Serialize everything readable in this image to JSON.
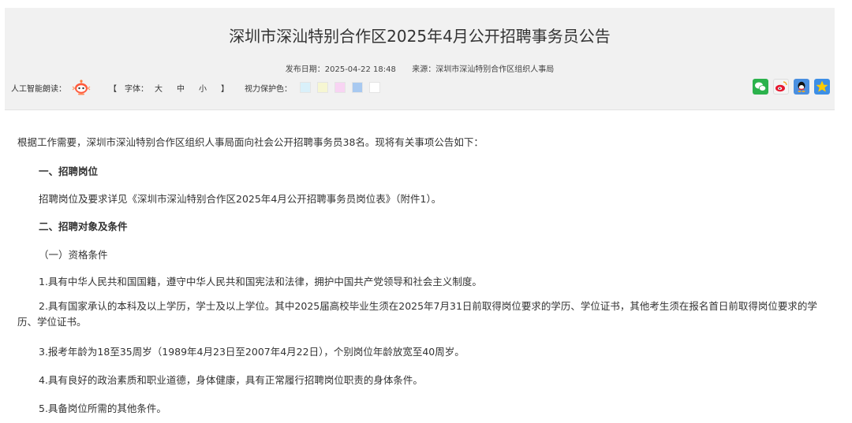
{
  "header": {
    "title": "深圳市深汕特别合作区2025年4月公开招聘事务员公告",
    "publish_label": "发布日期：",
    "publish_date": "2025-04-22 18:48",
    "source_label": "来源：",
    "source": "深圳市深汕特别合作区组织人事局"
  },
  "tools": {
    "ai_read_label": "人工智能朗读：",
    "font_bracket_open": "【",
    "font_label": "字体：",
    "font_large": "大",
    "font_medium": "中",
    "font_small": "小",
    "font_bracket_close": "】",
    "eye_protect_label": "视力保护色：",
    "eye_colors": [
      "#d9f0fa",
      "#f6f6d2",
      "#f8d4f3",
      "#a8c9f0",
      "#ffffff"
    ]
  },
  "share": [
    "wechat-icon",
    "weibo-icon",
    "qq-icon",
    "qzone-icon"
  ],
  "content": {
    "intro": "根据工作需要，深圳市深汕特别合作区组织人事局面向社会公开招聘事务员38名。现将有关事项公告如下：",
    "section1_title": "一、招聘岗位",
    "section1_text": "招聘岗位及要求详见《深圳市深汕特别合作区2025年4月公开招聘事务员岗位表》（附件1）。",
    "section2_title": "二、招聘对象及条件",
    "sub1_title": "（一）资格条件",
    "item1": "1.具有中华人民共和国国籍，遵守中华人民共和国宪法和法律，拥护中国共产党领导和社会主义制度。",
    "item2": "2.具有国家承认的本科及以上学历，学士及以上学位。其中2025届高校毕业生须在2025年7月31日前取得岗位要求的学历、学位证书，其他考生须在报名首日前取得岗位要求的学历、学位证书。",
    "item3": "3.报考年龄为18至35周岁（1989年4月23日至2007年4月22日），个别岗位年龄放宽至40周岁。",
    "item4": "4.具有良好的政治素质和职业道德，身体健康，具有正常履行招聘岗位职责的身体条件。",
    "item5": "5.具备岗位所需的其他条件。"
  }
}
